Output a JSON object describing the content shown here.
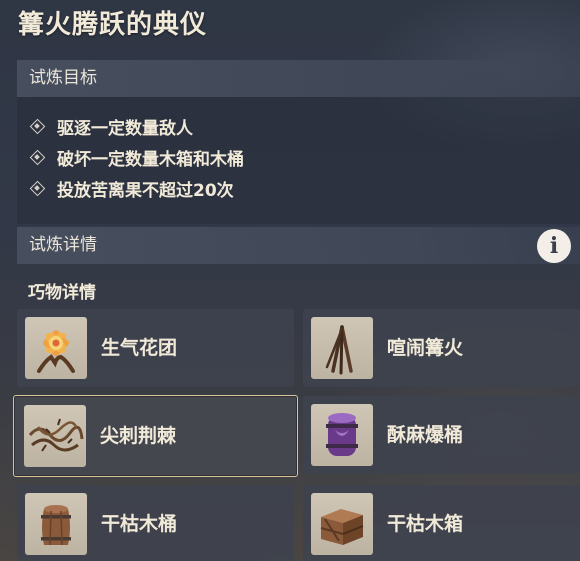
{
  "title": "篝火腾跃的典仪",
  "objectives": {
    "header": "试炼目标",
    "items": [
      "驱逐一定数量敌人",
      "破坏一定数量木箱和木桶",
      "投放苦离果不超过20次"
    ]
  },
  "details": {
    "header": "试炼详情",
    "info_icon": "info-icon",
    "subheading": "巧物详情",
    "gadgets": [
      {
        "label": "生气花团",
        "icon": "flower-cluster-icon"
      },
      {
        "label": "喧闹篝火",
        "icon": "bonfire-icon"
      },
      {
        "label": "尖刺荆棘",
        "icon": "thorns-icon",
        "selected": true
      },
      {
        "label": "酥麻爆桶",
        "icon": "purple-barrel-icon"
      },
      {
        "label": "干枯木桶",
        "icon": "wooden-barrel-icon"
      },
      {
        "label": "干枯木箱",
        "icon": "wooden-crate-icon"
      }
    ]
  },
  "colors": {
    "selected_border": "#d8c49a",
    "text": "#f1ead9"
  }
}
